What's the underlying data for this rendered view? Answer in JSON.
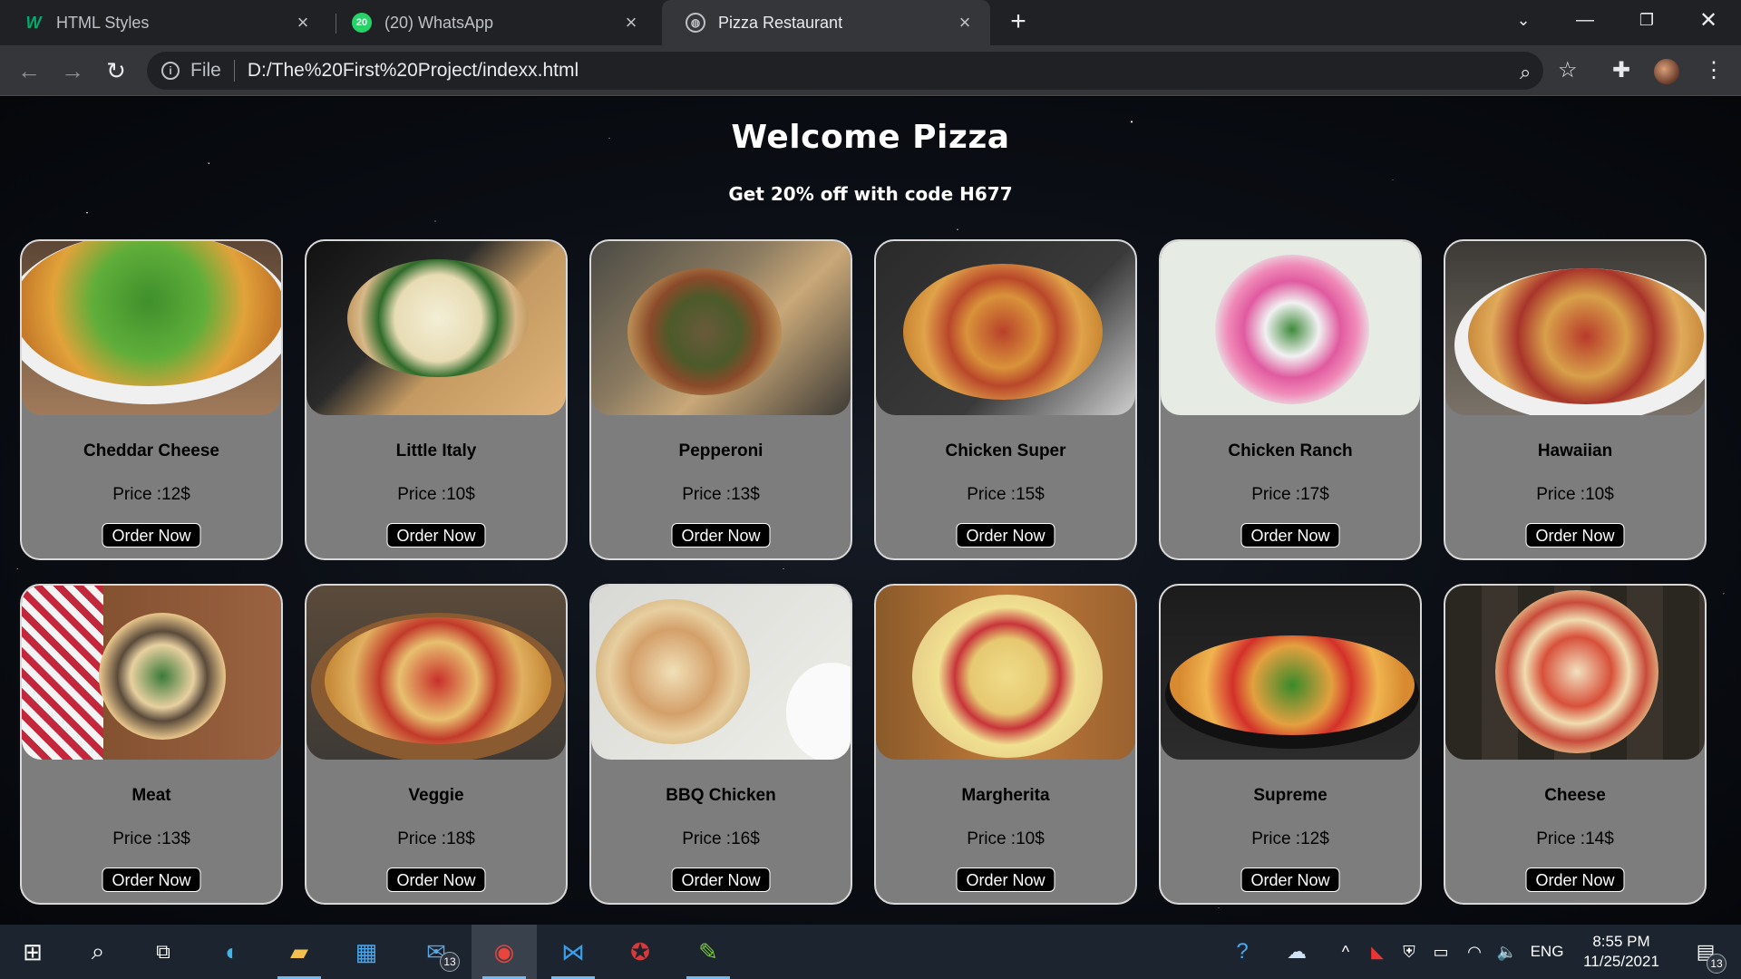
{
  "browser": {
    "tabs": [
      {
        "title": "HTML Styles",
        "favicon": "w3schools-icon",
        "active": false
      },
      {
        "title": "(20) WhatsApp",
        "favicon": "whatsapp-icon",
        "badge": "20",
        "active": false
      },
      {
        "title": "Pizza Restaurant",
        "favicon": "globe-icon",
        "active": true
      }
    ],
    "address": {
      "scheme": "File",
      "url": "D:/The%20First%20Project/indexx.html"
    }
  },
  "page": {
    "title": "Welcome Pizza",
    "promo": "Get 20% off with code H677",
    "button_label": "Order Now",
    "pizzas": [
      {
        "name": "Cheddar Cheese",
        "price": "Price :12$"
      },
      {
        "name": "Little Italy",
        "price": "Price :10$"
      },
      {
        "name": "Pepperoni",
        "price": "Price :13$"
      },
      {
        "name": "Chicken Super",
        "price": "Price :15$"
      },
      {
        "name": "Chicken Ranch",
        "price": "Price :17$"
      },
      {
        "name": "Hawaiian",
        "price": "Price :10$"
      },
      {
        "name": "Meat",
        "price": "Price :13$"
      },
      {
        "name": "Veggie",
        "price": "Price :18$"
      },
      {
        "name": "BBQ Chicken",
        "price": "Price :16$"
      },
      {
        "name": "Margherita",
        "price": "Price :10$"
      },
      {
        "name": "Supreme",
        "price": "Price :12$"
      },
      {
        "name": "Cheese",
        "price": "Price :14$"
      }
    ]
  },
  "taskbar": {
    "mail_badge": "13",
    "language": "ENG",
    "time": "8:55 PM",
    "date": "11/25/2021",
    "notification_badge": "13"
  }
}
